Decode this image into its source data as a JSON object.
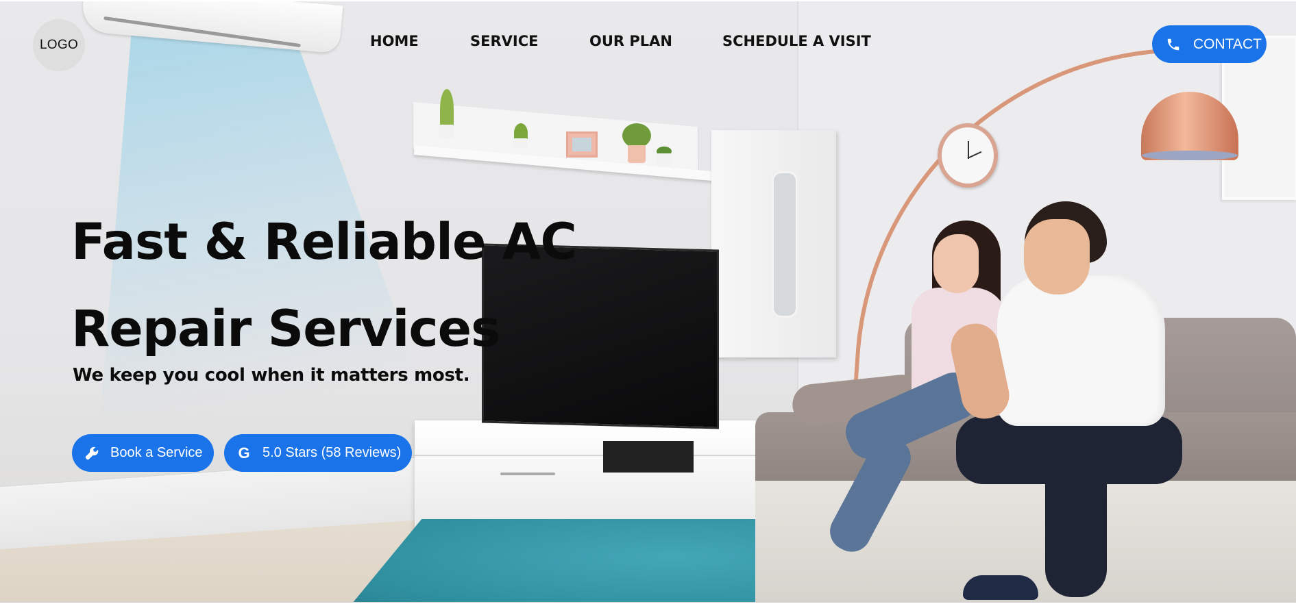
{
  "brand": {
    "logo_text": "LOGO"
  },
  "nav": {
    "items": [
      {
        "label": "HOME"
      },
      {
        "label": "SERVICE"
      },
      {
        "label": "OUR PLAN"
      },
      {
        "label": "SCHEDULE A VISIT"
      }
    ],
    "contact": {
      "label": "CONTACT",
      "icon": "phone-icon"
    }
  },
  "hero": {
    "title_line1": "Fast & Reliable AC",
    "title_line2": "Repair Services",
    "subtitle": "We keep you cool when it matters most.",
    "buttons": {
      "book": {
        "label": "Book a Service",
        "icon": "wrench-icon"
      },
      "reviews": {
        "label": "5.0 Stars (58 Reviews)",
        "icon": "google-icon",
        "icon_glyph": "G"
      }
    }
  },
  "colors": {
    "accent": "#1a73e8",
    "text": "#0b0b0b",
    "logo_bg": "#dedede"
  }
}
